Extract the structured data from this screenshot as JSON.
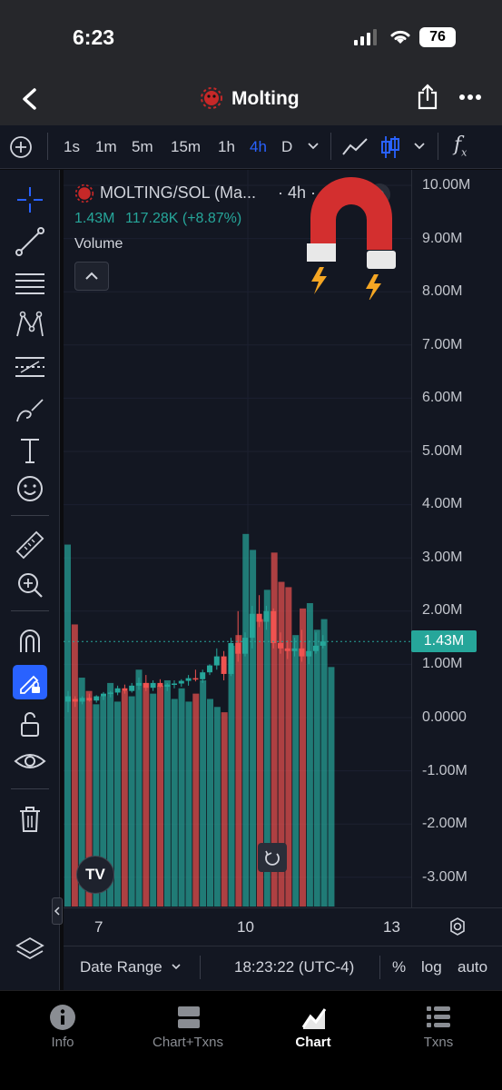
{
  "status_bar": {
    "time": "6:23",
    "battery": "76"
  },
  "header": {
    "title": "Molting"
  },
  "timeframes": [
    "1s",
    "1m",
    "5m",
    "15m",
    "1h",
    "4h",
    "D"
  ],
  "active_timeframe": "4h",
  "legend": {
    "symbol": "MOLTING/SOL (Ma...",
    "interval": "· 4h · d...",
    "volume_value": "1.43M",
    "change": "117.28K (+8.87%)",
    "volume_label": "Volume"
  },
  "price_axis": [
    "10.00M",
    "9.00M",
    "8.00M",
    "7.00M",
    "6.00M",
    "5.00M",
    "4.00M",
    "3.00M",
    "2.00M",
    "1.00M",
    "0.0000",
    "-1.00M",
    "-2.00M",
    "-3.00M"
  ],
  "current_price_label": "1.43M",
  "time_axis": [
    "7",
    "10",
    "13"
  ],
  "bottom_bar": {
    "date_range": "Date Range",
    "clock": "18:23:22 (UTC-4)",
    "percent": "%",
    "log": "log",
    "auto": "auto"
  },
  "tabs": [
    {
      "label": "Info",
      "icon": "info-icon"
    },
    {
      "label": "Chart+Txns",
      "icon": "chart-txns-icon"
    },
    {
      "label": "Chart",
      "icon": "chart-icon",
      "active": true
    },
    {
      "label": "Txns",
      "icon": "list-icon"
    }
  ],
  "colors": {
    "up": "#26a69a",
    "down": "#ef5350",
    "accent": "#2962ff",
    "background": "#131722"
  },
  "chart_data": {
    "type": "candlestick",
    "ylim": [
      -3500000,
      10500000
    ],
    "current_price": 1430000,
    "ohlc": [
      [
        300000,
        500000,
        100000,
        400000
      ],
      [
        350000,
        400000,
        200000,
        300000
      ],
      [
        300000,
        400000,
        250000,
        370000
      ],
      [
        370000,
        450000,
        300000,
        320000
      ],
      [
        320000,
        420000,
        280000,
        400000
      ],
      [
        400000,
        480000,
        330000,
        450000
      ],
      [
        450000,
        500000,
        380000,
        470000
      ],
      [
        470000,
        600000,
        420000,
        550000
      ],
      [
        550000,
        620000,
        450000,
        500000
      ],
      [
        500000,
        650000,
        470000,
        600000
      ],
      [
        600000,
        750000,
        520000,
        650000
      ],
      [
        650000,
        800000,
        500000,
        560000
      ],
      [
        560000,
        700000,
        500000,
        650000
      ],
      [
        650000,
        720000,
        560000,
        580000
      ],
      [
        580000,
        650000,
        500000,
        620000
      ],
      [
        620000,
        700000,
        550000,
        640000
      ],
      [
        640000,
        720000,
        580000,
        690000
      ],
      [
        690000,
        800000,
        600000,
        740000
      ],
      [
        740000,
        900000,
        680000,
        720000
      ],
      [
        720000,
        900000,
        650000,
        850000
      ],
      [
        850000,
        1000000,
        800000,
        980000
      ],
      [
        980000,
        1300000,
        900000,
        1150000
      ],
      [
        1150000,
        1250000,
        700000,
        820000
      ],
      [
        820000,
        1500000,
        780000,
        1400000
      ],
      [
        1400000,
        2000000,
        1050000,
        1200000
      ],
      [
        1200000,
        1600000,
        1150000,
        1500000
      ],
      [
        1500000,
        2100000,
        1300000,
        1950000
      ],
      [
        1950000,
        2300000,
        1700000,
        1800000
      ],
      [
        1800000,
        2100000,
        1650000,
        2000000
      ],
      [
        2000000,
        2050000,
        1300000,
        1400000
      ],
      [
        1400000,
        1600000,
        1200000,
        1300000
      ],
      [
        1300000,
        1450000,
        1100000,
        1250000
      ],
      [
        1250000,
        1500000,
        1150000,
        1300000
      ],
      [
        1300000,
        1650000,
        1050000,
        1150000
      ],
      [
        1150000,
        1450000,
        1000000,
        1250000
      ],
      [
        1250000,
        1600000,
        1200000,
        1350000
      ],
      [
        1350000,
        1550000,
        1300000,
        1430000
      ]
    ],
    "volume": [
      3250000,
      1750000,
      750000,
      500000,
      250000,
      400000,
      650000,
      300000,
      500000,
      400000,
      900000,
      650000,
      450000,
      600000,
      700000,
      350000,
      550000,
      300000,
      450000,
      700000,
      350000,
      200000,
      100000,
      1350000,
      1550000,
      3450000,
      3150000,
      1850000,
      2400000,
      3100000,
      2550000,
      2450000,
      1550000,
      2050000,
      2150000,
      1650000,
      1850000,
      950000
    ]
  }
}
